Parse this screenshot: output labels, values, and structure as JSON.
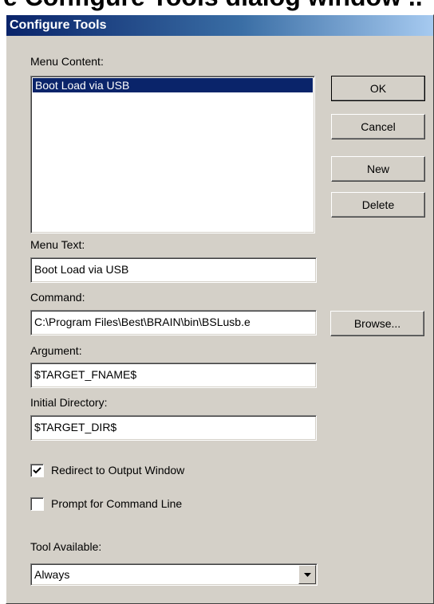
{
  "header_crop": "e Configure Tools dialog window ..",
  "dialog": {
    "title": "Configure Tools",
    "menu_content_label": "Menu Content:",
    "menu_items": [
      "Boot Load via USB"
    ],
    "buttons": {
      "ok": "OK",
      "cancel": "Cancel",
      "new": "New",
      "delete": "Delete",
      "browse": "Browse..."
    },
    "menu_text_label": "Menu Text:",
    "menu_text_value": "Boot Load via USB",
    "command_label": "Command:",
    "command_value": "C:\\Program Files\\Best\\BRAIN\\bin\\BSLusb.e",
    "argument_label": "Argument:",
    "argument_value": "$TARGET_FNAME$",
    "initial_dir_label": "Initial Directory:",
    "initial_dir_value": "$TARGET_DIR$",
    "redirect_label": "Redirect to Output Window",
    "redirect_checked": true,
    "prompt_label": "Prompt for Command Line",
    "prompt_checked": false,
    "tool_available_label": "Tool Available:",
    "tool_available_value": "Always"
  }
}
